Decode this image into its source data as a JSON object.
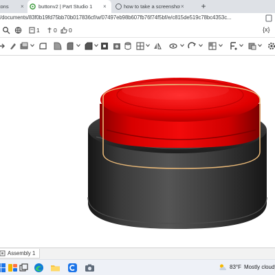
{
  "browser": {
    "tabs": [
      {
        "title": "buttons",
        "close": "×"
      },
      {
        "title": "buttonv2 | Part Studio 1",
        "close": "×",
        "active": true
      },
      {
        "title": "how to take a screenshot on an e",
        "close": "×"
      }
    ],
    "new_tab": "+",
    "url": "/documents/83f0b19fd75bb70b017836cf/w/07497eb98b607fb76f74f5bf/e/c815de519c78bc4353c..."
  },
  "doc_toolbar": {
    "versions_count": "1",
    "comments_count": "0",
    "likes_count": "0",
    "variable_label": "{x}"
  },
  "bottom_tabs": {
    "assembly_label": "Assembly 1"
  },
  "taskbar": {
    "temperature": "83°F",
    "weather_text": "Mostly cloudy"
  },
  "colors": {
    "button_red": "#e00000",
    "base_dark": "#2b2b2b",
    "highlight_edge": "#e8b878",
    "taskbar_bg": "#eef1f7"
  },
  "icons": [
    "onshape-favicon",
    "search-icon",
    "share-icon",
    "arrow-icon",
    "brush-icon",
    "sketch-icon",
    "extrude-icon",
    "revolve-icon",
    "fillet-icon",
    "chamfer-icon",
    "shell-icon",
    "hole-icon",
    "plane-icon",
    "mirror-icon",
    "pattern-icon",
    "boolean-icon",
    "split-icon",
    "transform-icon",
    "settings-icon",
    "windows-start-icon",
    "task-view-icon",
    "edge-icon",
    "file-explorer-icon",
    "chrome-icon",
    "camera-icon",
    "weather-icon"
  ]
}
